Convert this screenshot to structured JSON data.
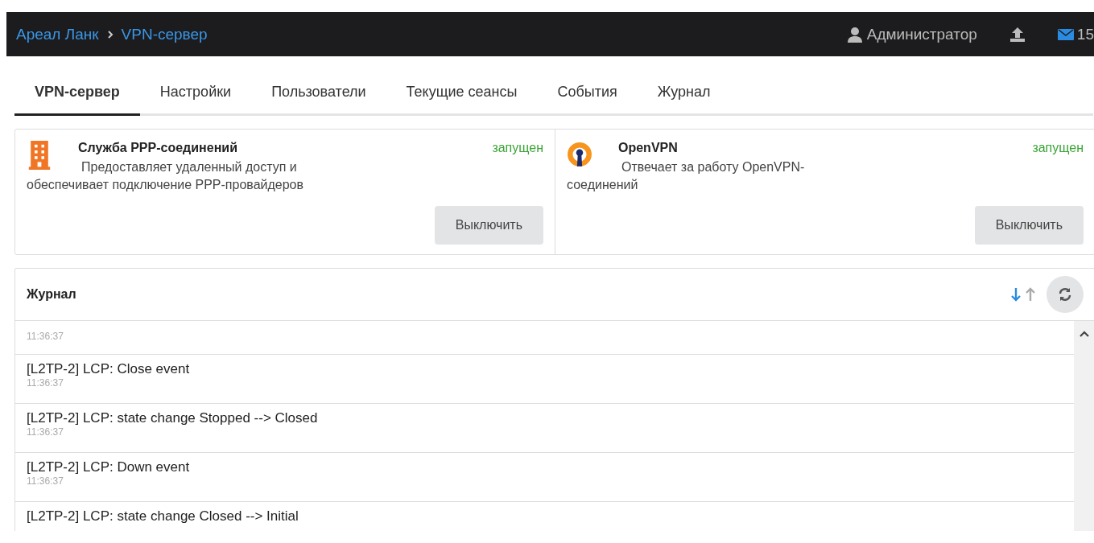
{
  "header": {
    "breadcrumbs": [
      "Ареал Ланк",
      "VPN-сервер"
    ],
    "user": "Администратор",
    "messages": "15"
  },
  "tabs": [
    {
      "label": "VPN-сервер",
      "selected": true
    },
    {
      "label": "Настройки",
      "selected": false
    },
    {
      "label": "Пользователи",
      "selected": false
    },
    {
      "label": "Текущие сеансы",
      "selected": false
    },
    {
      "label": "События",
      "selected": false
    },
    {
      "label": "Журнал",
      "selected": false
    }
  ],
  "services": [
    {
      "kind": "building",
      "title": "Служба PPP-соединений",
      "description": "Предоставляет удаленный доступ и обеспечивает подключение PPP-провайдеров",
      "status": "запущен",
      "button": "Выключить"
    },
    {
      "kind": "keyhole",
      "title": "OpenVPN",
      "description": "Отвечает за работу OpenVPN-соединений",
      "status": "запущен",
      "button": "Выключить"
    }
  ],
  "log": {
    "title": "Журнал",
    "sort": [
      {
        "kind": "down",
        "selected": true
      },
      {
        "kind": "up",
        "selected": false
      }
    ],
    "rows": [
      {
        "time": "11:36:37"
      },
      {
        "message": "[L2TP-2] LCP: Close event",
        "time": "11:36:37"
      },
      {
        "message": "[L2TP-2] LCP: state change Stopped --> Closed",
        "time": "11:36:37"
      },
      {
        "message": "[L2TP-2] LCP: Down event",
        "time": "11:36:37"
      },
      {
        "message": "[L2TP-2] LCP: state change Closed --> Initial"
      }
    ]
  }
}
